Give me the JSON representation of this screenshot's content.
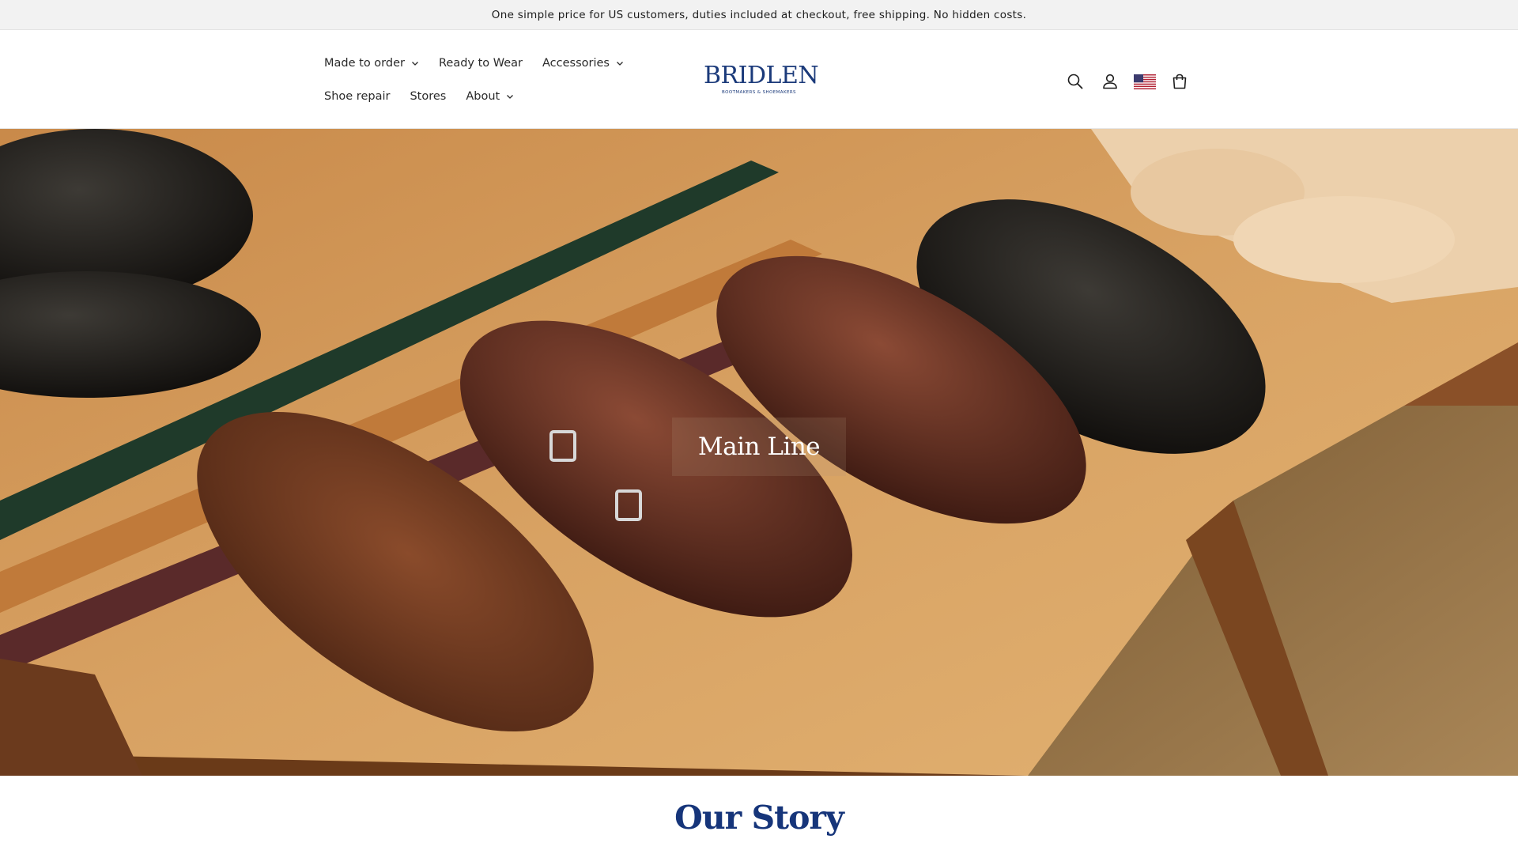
{
  "announcement": {
    "text": "One simple price for US customers, duties included at checkout, free shipping. No hidden costs."
  },
  "nav": {
    "row1": [
      {
        "label": "Made to order",
        "has_dropdown": true
      },
      {
        "label": "Ready to Wear",
        "has_dropdown": false
      },
      {
        "label": "Accessories",
        "has_dropdown": true
      }
    ],
    "row2": [
      {
        "label": "Shoe repair",
        "has_dropdown": false
      },
      {
        "label": "Stores",
        "has_dropdown": false
      },
      {
        "label": "About",
        "has_dropdown": true
      }
    ]
  },
  "logo": {
    "wordmark": "BRIDLEN",
    "tagline": "BOOTMAKERS & SHOEMAKERS",
    "brand_color": "#1b3a7a"
  },
  "header_icons": [
    "search-icon",
    "account-icon",
    "us-flag-icon",
    "cart-icon"
  ],
  "hero": {
    "label": "Main Line"
  },
  "story": {
    "heading": "Our Story"
  },
  "colors": {
    "announcement_bg": "#f2f2f2",
    "heading_blue": "#16357a",
    "text": "#1c1c1c"
  }
}
